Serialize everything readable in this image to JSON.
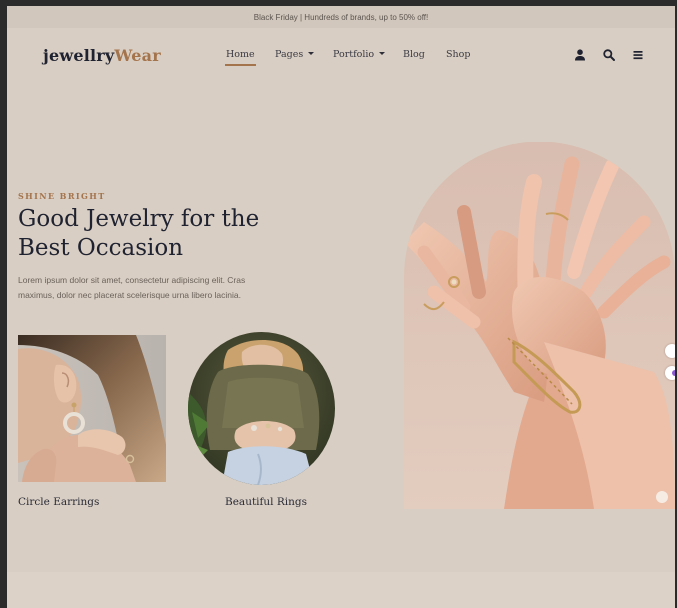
{
  "announcement": "Black Friday | Hundreds of brands, up to 50% off!",
  "logo": {
    "part1": "jewellry",
    "part2": "Wear"
  },
  "nav": {
    "home": "Home",
    "pages": "Pages",
    "portfolio": "Portfolio",
    "blog": "Blog",
    "shop": "Shop"
  },
  "icons": {
    "account": "user-icon",
    "search": "search-icon",
    "menu": "hamburger-icon"
  },
  "hero": {
    "eyebrow": "SHINE BRIGHT",
    "title": "Good Jewelry for the Best Occasion",
    "text": "Lorem ipsum dolor sit amet, consectetur adipiscing elit. Cras maximus, dolor nec placerat scelerisque urna libero lacinia."
  },
  "cards": {
    "earrings": "Circle Earrings",
    "rings": "Beautiful Rings"
  },
  "colors": {
    "accent": "#a4744c",
    "background": "#d9cec3",
    "heading": "#1f2230"
  }
}
